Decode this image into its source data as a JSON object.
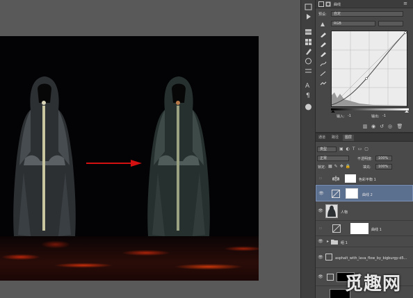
{
  "properties": {
    "header_title": "曲线",
    "preset_label": "预设:",
    "preset_value": "自定",
    "channel_value": "RGB",
    "input_label": "输入:",
    "input_value": "-1",
    "output_label": "输出:",
    "output_value": "-1"
  },
  "layers_panel": {
    "tabs": [
      "图层",
      "通道",
      "路径"
    ],
    "filter_kind": "类型",
    "blend_mode": "正常",
    "opacity_label": "不透明度:",
    "opacity_value": "100%",
    "lock_label": "锁定:",
    "fill_label": "填充:",
    "fill_value": "100%",
    "layers": [
      {
        "name": "色彩平衡 1",
        "visible": false
      },
      {
        "name": "曲线 2",
        "visible": true,
        "selected": true
      },
      {
        "name": "人物",
        "visible": true
      },
      {
        "name": "曲线 1",
        "visible": false
      },
      {
        "name": "组 1",
        "visible": true
      },
      {
        "name": "asphalt_with_lava_flow_by_bigburgy-d5...",
        "visible": true
      },
      {
        "name": "",
        "visible": true
      }
    ]
  },
  "watermark_text": "觅趣网",
  "colors": {
    "arrow": "#d41010",
    "panel_bg": "#474747",
    "canvas_bg": "#030305",
    "selected_layer": "#5b6f8f"
  }
}
